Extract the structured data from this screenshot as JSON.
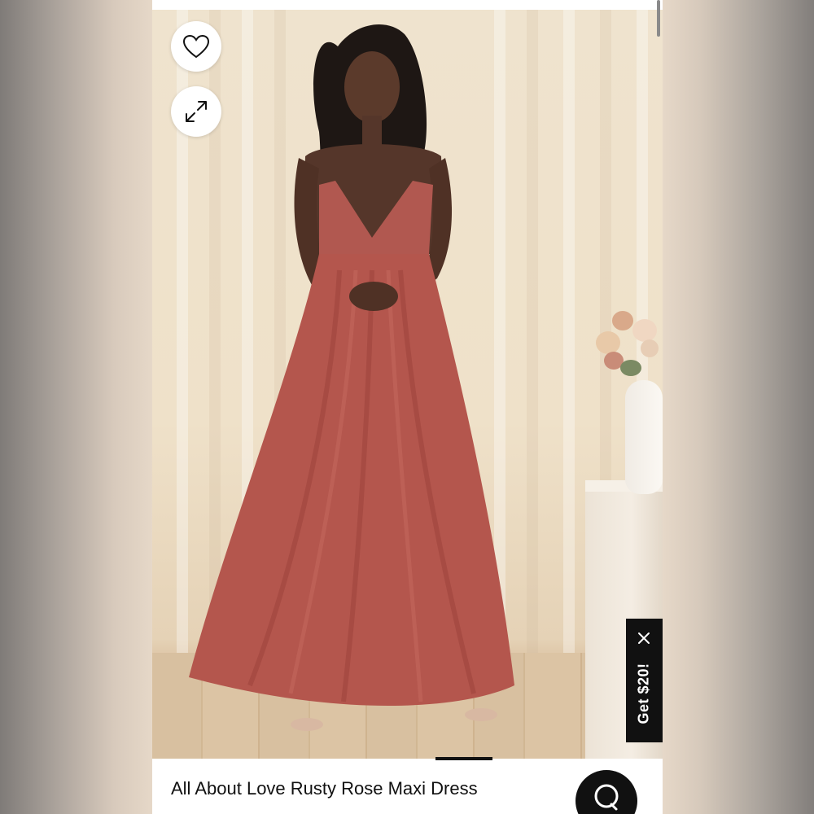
{
  "product": {
    "title": "All About Love Rusty Rose Maxi Dress"
  },
  "promo": {
    "label": "Get $20!"
  },
  "icons": {
    "favorite": "heart-icon",
    "expand": "expand-icon",
    "close": "close-icon",
    "chat": "chat-icon"
  },
  "colors": {
    "dress": "#b5574e",
    "promo_bg": "#111111",
    "chat_bg": "#111111"
  }
}
